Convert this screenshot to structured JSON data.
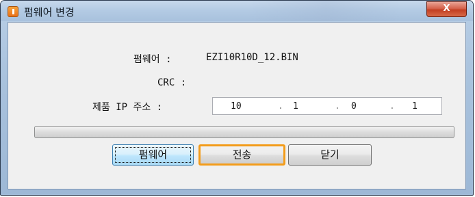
{
  "window": {
    "title": "펌웨어 변경",
    "close_label": "X",
    "app_icon": "app-orange-icon"
  },
  "form": {
    "firmware_label": "펌웨어 :",
    "firmware_value": "EZI10R10D_12.BIN",
    "crc_label": "CRC :",
    "crc_value": "",
    "ip_label": "제품 IP 주소 :",
    "ip": {
      "octet1": "10",
      "octet2": "1",
      "octet3": "0",
      "octet4": "1",
      "separator": "."
    }
  },
  "progress": {
    "value": 0
  },
  "buttons": {
    "firmware": "펌웨어",
    "send": "전송",
    "close": "닫기"
  },
  "colors": {
    "highlight": "#f39c1a",
    "titlebar": "#b4cbe4",
    "close_button": "#c23f22"
  }
}
